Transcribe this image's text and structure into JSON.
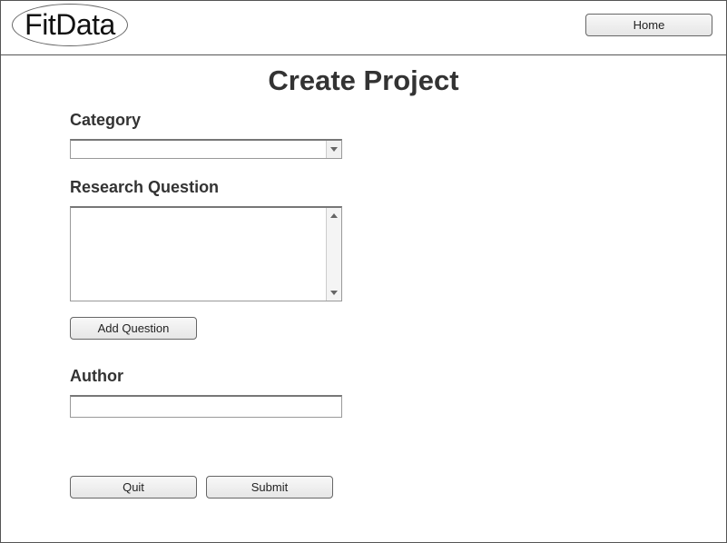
{
  "header": {
    "logo_text": "FitData",
    "home_label": "Home"
  },
  "page": {
    "title": "Create Project"
  },
  "form": {
    "category_label": "Category",
    "category_value": "",
    "research_question_label": "Research Question",
    "research_question_value": "",
    "add_question_label": "Add Question",
    "author_label": "Author",
    "author_value": ""
  },
  "actions": {
    "quit_label": "Quit",
    "submit_label": "Submit"
  }
}
